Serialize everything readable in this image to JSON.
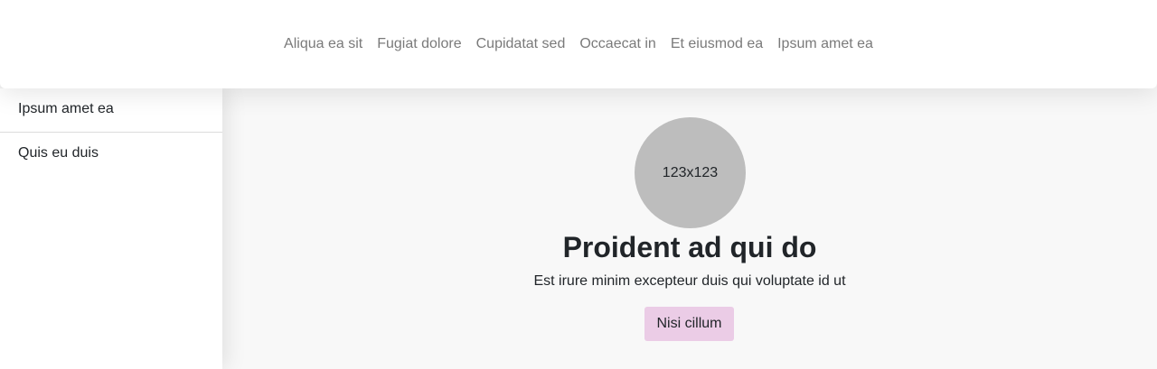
{
  "top_nav": {
    "items": [
      {
        "label": "Aliqua ea sit"
      },
      {
        "label": "Fugiat dolore"
      },
      {
        "label": "Cupidatat sed"
      },
      {
        "label": "Occaecat in"
      },
      {
        "label": "Et eiusmod ea"
      },
      {
        "label": "Ipsum amet ea"
      }
    ]
  },
  "sidebar": {
    "items": [
      {
        "label": "Ipsum amet ea"
      },
      {
        "label": "Quis eu duis"
      }
    ]
  },
  "hero": {
    "avatar_text": "123x123",
    "title": "Proident ad qui do",
    "subtitle": "Est irure minim excepteur duis qui voluptate id ut",
    "button_label": "Nisi cillum"
  },
  "colors": {
    "nav_link": "#7a7a7a",
    "avatar_bg": "#bdbdbd",
    "button_bg": "#ebcce6",
    "page_bg": "#f8f8f8"
  }
}
